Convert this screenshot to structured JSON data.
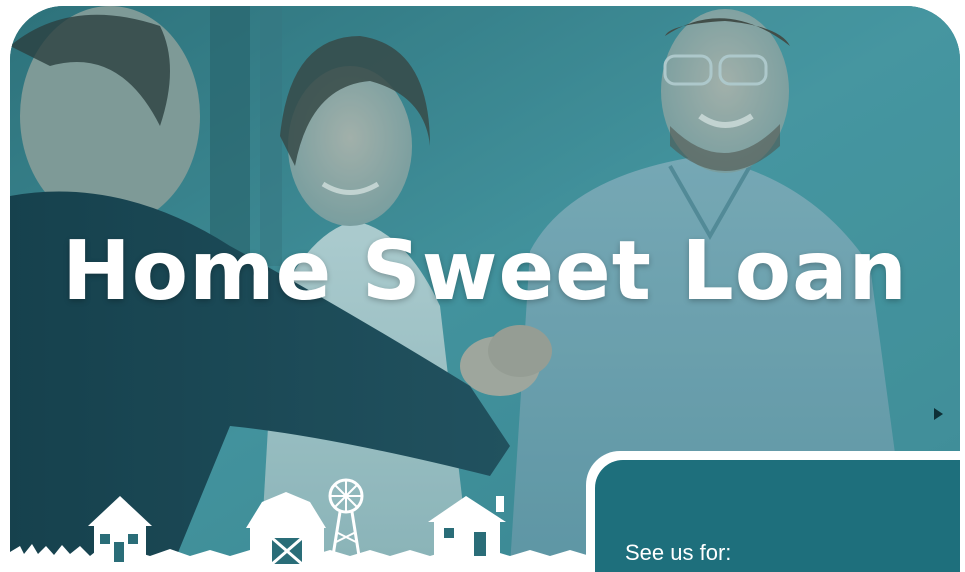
{
  "banner": {
    "headline": "Home Sweet Loan",
    "image_description_icon": "handshake-photo",
    "overlay_color": "#2a7d88"
  },
  "info_card": {
    "text": "See us for:",
    "background_color": "#1e6f7c"
  },
  "icons": {
    "houses": [
      "house-icon",
      "barn-icon",
      "windmill-icon",
      "cottage-icon"
    ],
    "marker": "triangle-marker-icon"
  }
}
